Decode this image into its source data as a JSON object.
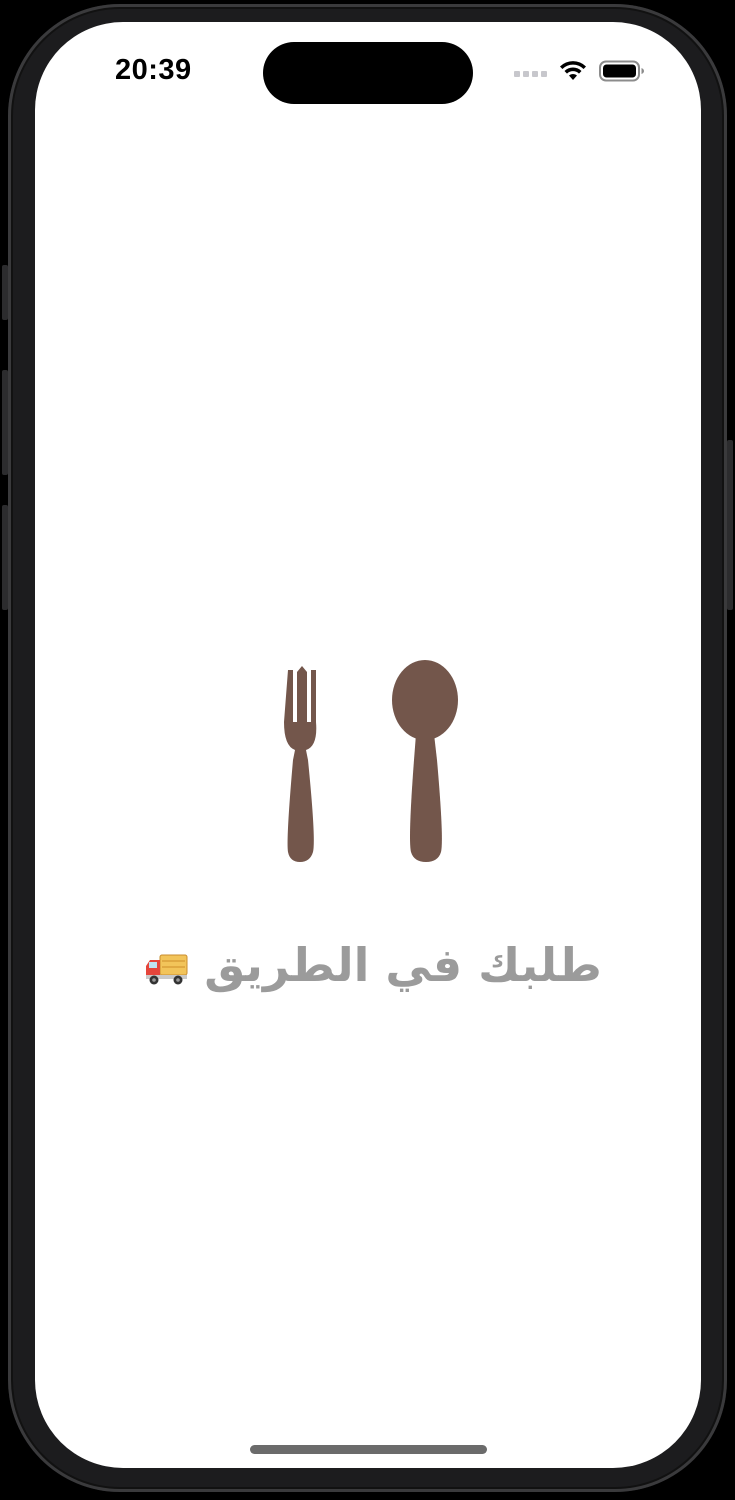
{
  "status_bar": {
    "time": "20:39"
  },
  "main": {
    "message": "طلبك في الطريق",
    "message_emoji": "delivery-truck-icon",
    "icon": "fork-and-spoon-icon"
  },
  "colors": {
    "utensils": "#73564b",
    "message_text": "#9b9b9b",
    "background": "#ffffff"
  }
}
